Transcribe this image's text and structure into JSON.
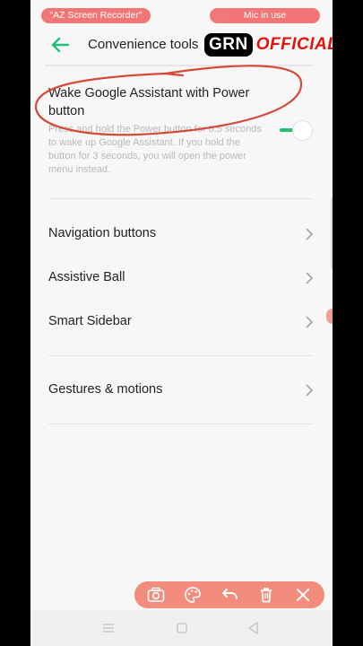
{
  "recording": {
    "app_pill": "\"AZ Screen Recorder\"",
    "mic_pill": "Mic in use"
  },
  "header": {
    "title": "Convenience tools",
    "watermark_left": "GRN",
    "watermark_right": "OFFICIAL"
  },
  "assistant_setting": {
    "title": "Wake Google Assistant with Power button",
    "description": "Press and hold the Power button for 0.5 seconds to wake up Google Assistant. If you hold the button for 3 seconds, you will open the power menu instead.",
    "enabled": true
  },
  "menu_items": [
    {
      "label": "Navigation buttons"
    },
    {
      "label": "Assistive Ball"
    },
    {
      "label": "Smart Sidebar"
    },
    {
      "label": "Gestures & motions"
    }
  ],
  "recorder_toolbar": {
    "buttons": [
      "camera-icon",
      "palette-icon",
      "undo-icon",
      "trash-icon",
      "close-icon"
    ]
  },
  "colors": {
    "accent_green": "#22c177",
    "recorder_pill": "#f26c6c",
    "annotation_red": "#d64a3a"
  }
}
